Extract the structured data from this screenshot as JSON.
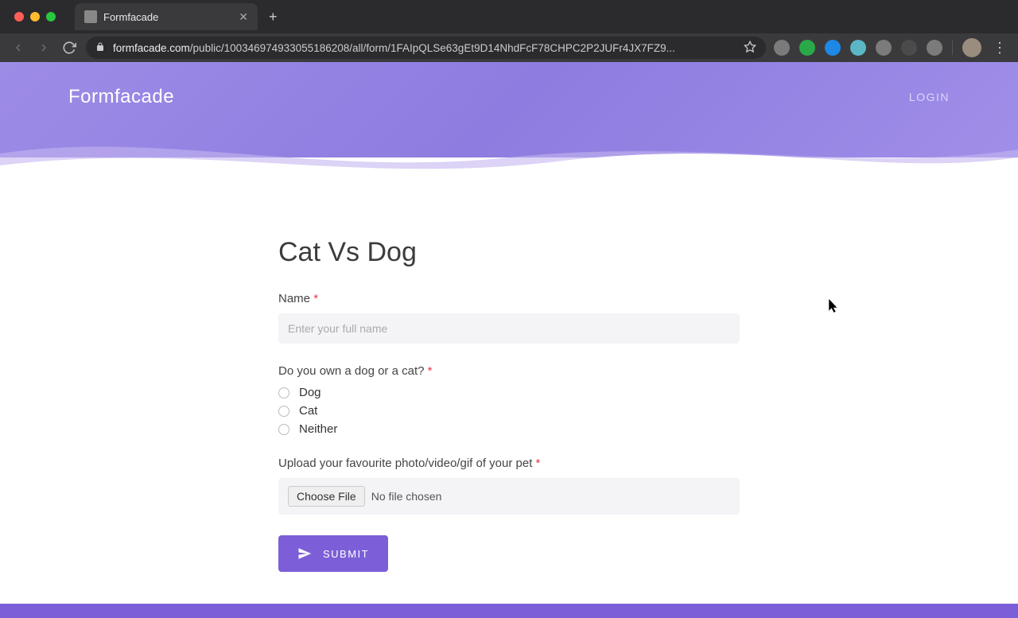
{
  "browser": {
    "tab_title": "Formfacade",
    "url_host": "formfacade.com",
    "url_path": "/public/100346974933055186208/all/form/1FAIpQLSe63gEt9D14NhdFcF78CHPC2P2JUFr4JX7FZ9..."
  },
  "header": {
    "brand": "Formfacade",
    "login": "LOGIN"
  },
  "form": {
    "title": "Cat Vs Dog",
    "name": {
      "label": "Name",
      "placeholder": "Enter your full name"
    },
    "pet_question": {
      "label": "Do you own a dog or a cat?",
      "options": [
        "Dog",
        "Cat",
        "Neither"
      ]
    },
    "upload": {
      "label": "Upload your favourite photo/video/gif of your pet",
      "button": "Choose File",
      "status": "No file chosen"
    },
    "submit": "SUBMIT"
  }
}
